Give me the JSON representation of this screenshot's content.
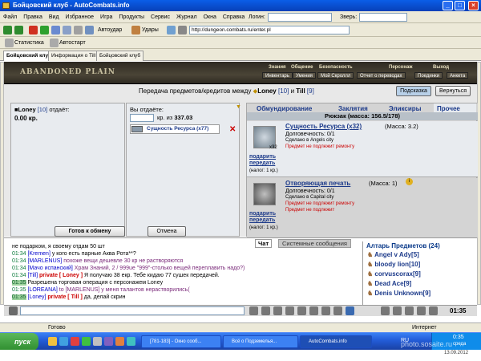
{
  "window": {
    "title": "Бойцовский клуб - AutoCombats.info"
  },
  "menu": [
    "Файл",
    "Правка",
    "Вид",
    "Избранное",
    "Игра",
    "Продукты",
    "Сервис",
    "Журнал",
    "Окна",
    "Справка"
  ],
  "login_label": "Логин:",
  "beast_label": "Зверь:",
  "toolbar": {
    "autoattack": "Автоудар",
    "punches": "Удары",
    "address": "http://dungeon.combats.ru/enter.pl"
  },
  "links": {
    "stats": "Статистика",
    "autostart": "Автостарт"
  },
  "tabs": [
    {
      "label": "Бойцовский клуб",
      "active": true
    },
    {
      "label": "Информация о Till",
      "active": false
    },
    {
      "label": "Бойцовский клуб",
      "active": false
    }
  ],
  "game": {
    "logo": "ABANDONED PLAIN",
    "menu_top": [
      "Знания",
      "Общение",
      "Безопасность",
      "Персонаж",
      "Выход"
    ],
    "menu_sub": [
      "Инвентарь",
      "Умения",
      "Мой Скроллл",
      "Отчет о переводах",
      "Поединки",
      "Анкета"
    ]
  },
  "trade": {
    "header_prefix": "Передача предметов/кредитов между",
    "player1": "Loney",
    "player1_level": "[10]",
    "and": "и",
    "player2": "Till",
    "player2_level": "[9]",
    "hint_btn": "Подсказка",
    "back_btn": "Вернуться",
    "left": {
      "gives_name": "Loney",
      "gives_level": "[10]",
      "gives_text": "отдаёт:",
      "credits": "0.00 кр."
    },
    "right": {
      "gives_text": "Вы отдаёте:",
      "amount_input": "",
      "amount_label": "кр. из",
      "amount_total": "337.03",
      "item": "Сущность Ресурса (x77)"
    },
    "ready_btn": "Готов к обмену",
    "cancel_btn": "Отмена",
    "inv_tabs": [
      "Обмундирование",
      "Заклятия",
      "Эликсиры",
      "Прочее"
    ],
    "backpack": "Рюкзак (масса: 156.5/178)",
    "items": [
      {
        "name": "Сущность Ресурса (x32)",
        "mass": "(Масса: 3.2)",
        "durability": "Долговечность: 0/1",
        "made": "Сделано в Angels city",
        "note": "Предмет не подлежит ремонту",
        "action": "подарить",
        "action2": "передать",
        "tax": "(налог: 1 кр.)",
        "count": "x32"
      },
      {
        "name": "Отворяющая печать",
        "mass": "(Масса: 1)",
        "durability": "Долговечность: 0/1",
        "made": "Сделано в Capital city",
        "note": "Предмет не подлежит ремонту",
        "note2": "Предмет не подлежит",
        "action": "подарить",
        "action2": "передать",
        "tax": "(налог: 1 кр.)"
      }
    ]
  },
  "chat": {
    "tab_chat": "Чат",
    "tab_sys": "Системные сообщения",
    "lines": [
      {
        "time": "",
        "who": "",
        "text": "не подарком, я своему отдам 50 шт"
      },
      {
        "time": "01:34",
        "who": "[Kremen]",
        "text": " у кого есть парные Аква Рота**?"
      },
      {
        "time": "01:34",
        "who": "[MARLENUS]",
        "text": " похоже вещи дешевле 30 кр не растворяются"
      },
      {
        "time": "01:34",
        "who": "[Мачо испанский]",
        "text": " Храм Знаний, 2 / 999ue \"999\"-столько вещей переплавить надо?)"
      },
      {
        "time": "01:34",
        "who": "[Till]",
        "pvt": " private [ Loney ]",
        "text": " Я получаю 38 екр. Тебе кидаю 77 сушек передачей."
      },
      {
        "time": "01:35",
        "who": "",
        "text": "Разрешена торговая операция с персонажем Loney",
        "hl": true
      },
      {
        "time": "01:35",
        "who": "[LOREANA]",
        "text": " to [MARLENUS] у меня талантов нерастворились("
      },
      {
        "time": "01:35",
        "who": "[Loney]",
        "pvt": " private [ Till ]",
        "text": " да, делай скрин",
        "hl": true
      }
    ]
  },
  "users": {
    "title": "Алтарь Предметов (24)",
    "list": [
      "Angel v Ady[5]",
      "bloody lion[10]",
      "corvuscorax[9]",
      "Dead Ace[9]",
      "Denis Unknown[9]"
    ]
  },
  "bottom_time": "01:35",
  "status": {
    "text": "Готово",
    "zone": "Интернет"
  },
  "taskbar": {
    "start": "пуск",
    "tasks": [
      "[781-183] - Окно сооб...",
      "Всё о Подземелья...",
      "AutoCombats.info"
    ],
    "lang": "RU",
    "clock": "0:35",
    "day": "среда",
    "date": "13.09.2012"
  },
  "watermark": "photo.sosaite.ru"
}
